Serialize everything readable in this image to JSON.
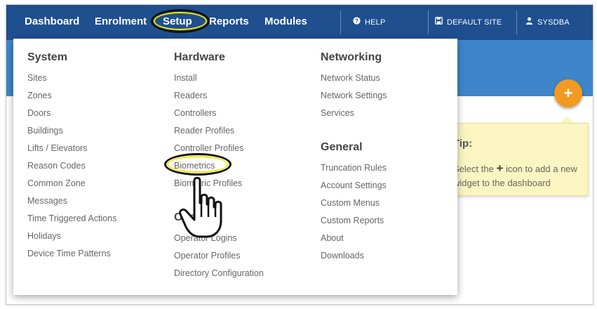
{
  "nav": {
    "dashboard": "Dashboard",
    "enrolment": "Enrolment",
    "setup": "Setup",
    "reports": "Reports",
    "modules": "Modules",
    "help": "HELP",
    "site": "DEFAULT SITE",
    "user": "SYSDBA"
  },
  "menu": {
    "system": {
      "heading": "System",
      "items": [
        "Sites",
        "Zones",
        "Doors",
        "Buildings",
        "Lifts / Elevators",
        "Reason Codes",
        "Common Zone",
        "Messages",
        "Time Triggered Actions",
        "Holidays",
        "Device Time Patterns"
      ]
    },
    "hardware": {
      "heading": "Hardware",
      "items": [
        "Install",
        "Readers",
        "Controllers",
        "Reader Profiles",
        "Controller Profiles",
        "Biometrics",
        "Biometric Profiles"
      ]
    },
    "operator": {
      "heading": "Operator",
      "items": [
        "Operator Logins",
        "Operator Profiles",
        "Directory Configuration"
      ]
    },
    "networking": {
      "heading": "Networking",
      "items": [
        "Network Status",
        "Network Settings",
        "Services"
      ]
    },
    "general": {
      "heading": "General",
      "items": [
        "Truncation Rules",
        "Account Settings",
        "Custom Menus",
        "Custom Reports",
        "About",
        "Downloads"
      ]
    }
  },
  "tip": {
    "title": "Tip:",
    "text_before": "Select the",
    "plus": "+",
    "text_after": "icon to add a new widget to the dashboard"
  },
  "add_button": "+",
  "icons": {
    "help": "question-circle-icon",
    "site": "floppy-disk-icon",
    "user": "user-icon",
    "cursor": "hand-pointer-icon"
  },
  "colors": {
    "topbar": "#1f4f8f",
    "subbar": "#3e86c9",
    "accent": "#f39a21",
    "highlight": "#f2e600",
    "tip_bg": "#fbf5c2"
  }
}
